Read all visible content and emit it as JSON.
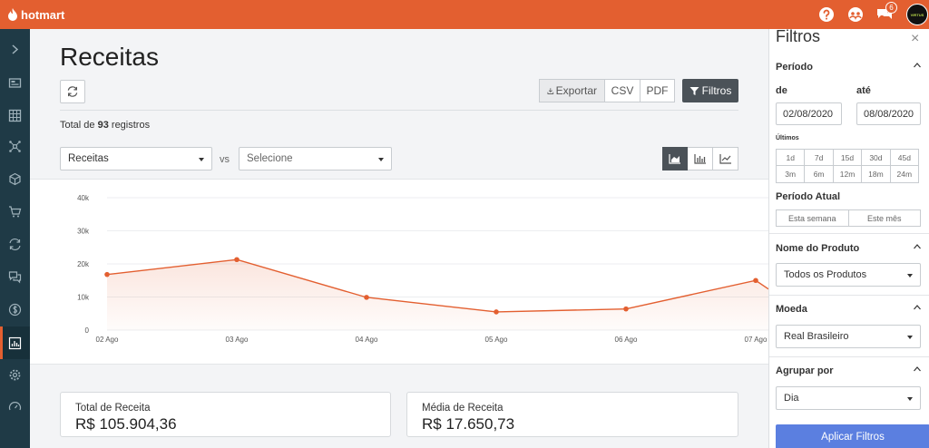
{
  "app": {
    "brand": "hotmart"
  },
  "topbar": {
    "notifications_count": "6",
    "avatar_text": "VIRTUS"
  },
  "page": {
    "title": "Receitas",
    "total_prefix": "Total de ",
    "total_count": "93",
    "total_suffix": " registros"
  },
  "toolbar": {
    "export_label": "Exportar",
    "csv_label": "CSV",
    "pdf_label": "PDF",
    "filters_label": "Filtros"
  },
  "compare": {
    "primary_value": "Receitas",
    "vs_label": "vs",
    "secondary_placeholder": "Selecione"
  },
  "chart_data": {
    "type": "area",
    "x": [
      "02 Ago",
      "03 Ago",
      "04 Ago",
      "05 Ago",
      "06 Ago",
      "07 Ago"
    ],
    "values": [
      16800,
      21300,
      9900,
      5500,
      6400,
      15000
    ],
    "ylim": [
      0,
      40000
    ],
    "y_ticks": [
      "0",
      "10k",
      "20k",
      "30k",
      "40k"
    ],
    "grid": true,
    "color": "#e35f30"
  },
  "cards": [
    {
      "label": "Total de Receita",
      "value": "R$ 105.904,36"
    },
    {
      "label": "Média de Receita",
      "value": "R$ 17.650,73"
    }
  ],
  "filters": {
    "title": "Filtros",
    "close": "×",
    "periodo": {
      "title": "Período",
      "from_label": "de",
      "to_label": "até",
      "from_value": "02/08/2020",
      "to_value": "08/08/2020",
      "ultimos_label": "Últimos",
      "ranges_row1": [
        "1d",
        "7d",
        "15d",
        "30d",
        "45d"
      ],
      "ranges_row2": [
        "3m",
        "6m",
        "12m",
        "18m",
        "24m"
      ],
      "atual_title": "Período Atual",
      "atual_options": [
        "Esta semana",
        "Este mês"
      ]
    },
    "produto": {
      "title": "Nome do Produto",
      "value": "Todos os Produtos"
    },
    "moeda": {
      "title": "Moeda",
      "value": "Real Brasileiro"
    },
    "agrupar": {
      "title": "Agrupar por",
      "value": "Dia"
    },
    "apply_label": "Aplicar Filtros"
  }
}
